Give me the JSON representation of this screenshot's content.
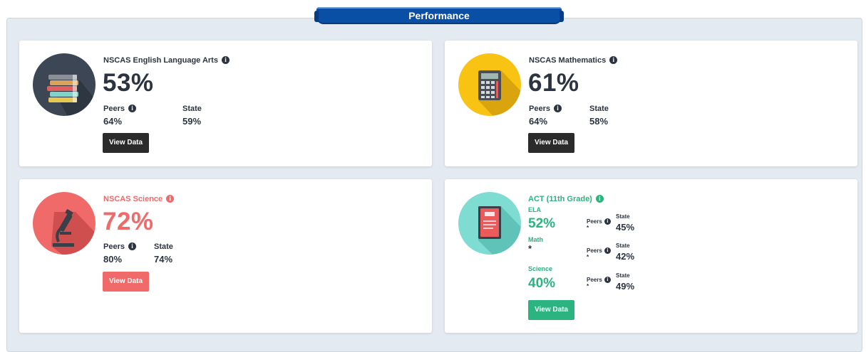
{
  "header": {
    "title": "Performance"
  },
  "cards": {
    "ela": {
      "title": "NSCAS English Language Arts",
      "percent": "53%",
      "peers_label": "Peers",
      "peers_value": "64%",
      "state_label": "State",
      "state_value": "59%",
      "button": "View Data",
      "icon": "books-icon",
      "colors": {
        "circle": "#3c4654",
        "text": "#2b3440",
        "button": "#2b2b2b"
      }
    },
    "math": {
      "title": "NSCAS Mathematics",
      "percent": "61%",
      "peers_label": "Peers",
      "peers_value": "64%",
      "state_label": "State",
      "state_value": "58%",
      "button": "View Data",
      "icon": "calculator-icon",
      "colors": {
        "circle": "#f8c313",
        "text": "#2b3440",
        "button": "#2b2b2b"
      }
    },
    "science": {
      "title": "NSCAS Science",
      "percent": "72%",
      "peers_label": "Peers",
      "peers_value": "80%",
      "state_label": "State",
      "state_value": "74%",
      "button": "View Data",
      "icon": "microscope-icon",
      "colors": {
        "circle": "#f06a6a",
        "text": "#f06a6a",
        "button": "#f06a6a"
      }
    },
    "act": {
      "title": "ACT (11th Grade)",
      "icon": "act-book-icon",
      "colors": {
        "circle": "#7fdcd3",
        "text": "#2bb380",
        "button": "#2bb380"
      },
      "subjects": [
        {
          "label": "ELA",
          "value": "52%",
          "peers_label": "Peers",
          "peers_value": "*",
          "state_label": "State",
          "state_value": "45%"
        },
        {
          "label": "Math",
          "value": "*",
          "peers_label": "Peers",
          "peers_value": "*",
          "state_label": "State",
          "state_value": "42%"
        },
        {
          "label": "Science",
          "value": "40%",
          "peers_label": "Peers",
          "peers_value": "*",
          "state_label": "State",
          "state_value": "49%"
        }
      ],
      "button": "View Data"
    }
  },
  "icons": {
    "info": "i"
  }
}
